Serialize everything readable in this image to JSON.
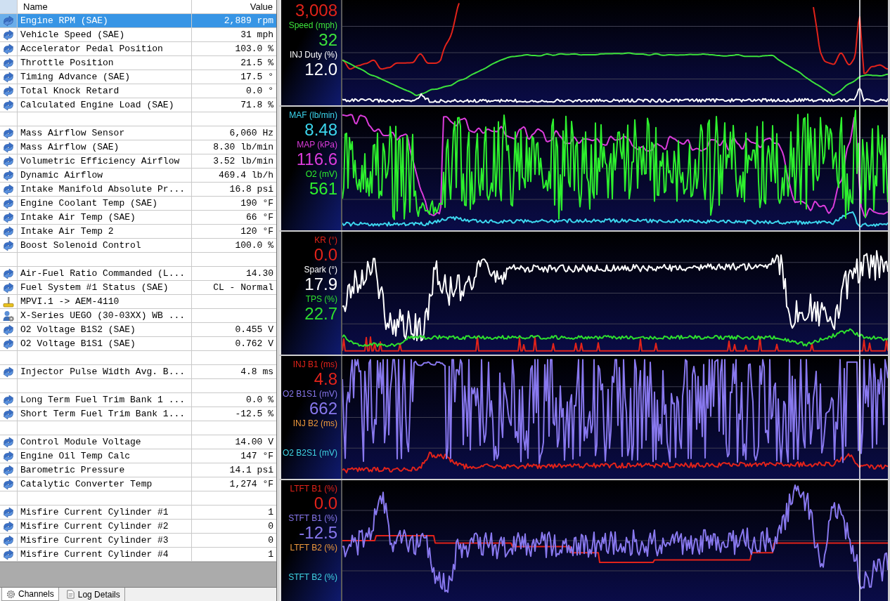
{
  "channel_table": {
    "columns": [
      "Name",
      "Value"
    ],
    "groups": [
      [
        {
          "kind": "channel",
          "name": "Engine RPM (SAE)",
          "value": "2,889 rpm",
          "selected": true
        },
        {
          "kind": "channel",
          "name": "Vehicle Speed (SAE)",
          "value": "31 mph",
          "selected": false
        },
        {
          "kind": "channel",
          "name": "Accelerator Pedal Position",
          "value": "103.0 %",
          "selected": false
        },
        {
          "kind": "channel",
          "name": "Throttle Position",
          "value": "21.5 %",
          "selected": false
        },
        {
          "kind": "channel",
          "name": "Timing Advance (SAE)",
          "value": "17.5 °",
          "selected": false
        },
        {
          "kind": "channel",
          "name": "Total Knock Retard",
          "value": "0.0 °",
          "selected": false
        },
        {
          "kind": "channel",
          "name": "Calculated Engine Load (SAE)",
          "value": "71.8 %",
          "selected": false
        }
      ],
      [
        {
          "kind": "channel",
          "name": "Mass Airflow Sensor",
          "value": "6,060 Hz",
          "selected": false
        },
        {
          "kind": "channel",
          "name": "Mass Airflow (SAE)",
          "value": "8.30 lb/min",
          "selected": false
        },
        {
          "kind": "channel",
          "name": "Volumetric Efficiency Airflow",
          "value": "3.52 lb/min",
          "selected": false
        },
        {
          "kind": "channel",
          "name": "Dynamic Airflow",
          "value": "469.4 lb/h",
          "selected": false
        },
        {
          "kind": "channel",
          "name": "Intake Manifold Absolute Pr...",
          "value": "16.8 psi",
          "selected": false
        },
        {
          "kind": "channel",
          "name": "Engine Coolant Temp (SAE)",
          "value": "190 °F",
          "selected": false
        },
        {
          "kind": "channel",
          "name": "Intake Air Temp (SAE)",
          "value": "66 °F",
          "selected": false
        },
        {
          "kind": "channel",
          "name": "Intake Air Temp 2",
          "value": "120 °F",
          "selected": false
        },
        {
          "kind": "channel",
          "name": "Boost Solenoid Control",
          "value": "100.0 %",
          "selected": false
        }
      ],
      [
        {
          "kind": "channel",
          "name": "Air-Fuel Ratio Commanded (L...",
          "value": "14.30",
          "selected": false
        },
        {
          "kind": "channel",
          "name": "Fuel System #1 Status (SAE)",
          "value": "CL - Normal",
          "selected": false
        },
        {
          "kind": "input",
          "name": "MPVI.1 -> AEM-4110",
          "selected": false
        },
        {
          "kind": "device",
          "name": "X-Series UEGO (30-03XX) WB ...",
          "selected": false
        },
        {
          "kind": "channel",
          "name": "O2 Voltage B1S2 (SAE)",
          "value": "0.455 V",
          "selected": false
        },
        {
          "kind": "channel",
          "name": "O2 Voltage B1S1 (SAE)",
          "value": "0.762 V",
          "selected": false
        }
      ],
      [
        {
          "kind": "channel",
          "name": "Injector Pulse Width Avg. B...",
          "value": "4.8 ms",
          "selected": false
        }
      ],
      [
        {
          "kind": "channel",
          "name": "Long Term Fuel Trim Bank 1 ...",
          "value": "0.0 %",
          "selected": false
        },
        {
          "kind": "channel",
          "name": "Short Term Fuel Trim Bank 1...",
          "value": "-12.5 %",
          "selected": false
        }
      ],
      [
        {
          "kind": "channel",
          "name": "Control Module Voltage",
          "value": "14.00 V",
          "selected": false
        },
        {
          "kind": "channel",
          "name": "Engine Oil Temp Calc",
          "value": "147 °F",
          "selected": false
        },
        {
          "kind": "channel",
          "name": "Barometric Pressure",
          "value": "14.1 psi",
          "selected": false
        },
        {
          "kind": "channel",
          "name": "Catalytic Converter Temp",
          "value": "1,274 °F",
          "selected": false
        }
      ],
      [
        {
          "kind": "channel",
          "name": "Misfire Current Cylinder #1",
          "value": "1",
          "selected": false
        },
        {
          "kind": "channel",
          "name": "Misfire Current Cylinder #2",
          "value": "0",
          "selected": false
        },
        {
          "kind": "channel",
          "name": "Misfire Current Cylinder #3",
          "value": "0",
          "selected": false
        },
        {
          "kind": "channel",
          "name": "Misfire Current Cylinder #4",
          "value": "1",
          "selected": false
        }
      ]
    ]
  },
  "tabs": [
    {
      "label": "Channels",
      "selected": true
    },
    {
      "label": "Log Details",
      "selected": false
    }
  ],
  "chart_panels": [
    {
      "channels": [
        {
          "value": "3,008",
          "color": "#e2231a"
        },
        {
          "label": "Speed (mph)",
          "value": "32",
          "color": "#3ce23c"
        },
        {
          "label": "INJ Duty (%)",
          "value": "12.0",
          "color": "#ffffff"
        }
      ]
    },
    {
      "channels": [
        {
          "label": "MAF (lb/min)",
          "value": "8.48",
          "color": "#3cd6ee"
        },
        {
          "label": "MAP (kPa)",
          "value": "116.6",
          "color": "#dc3cdc"
        },
        {
          "label": "O2 (mV)",
          "value": "561",
          "color": "#2ef02e"
        }
      ]
    },
    {
      "channels": [
        {
          "label": "KR (°)",
          "value": "0.0",
          "color": "#e2231a"
        },
        {
          "label": "Spark (°)",
          "value": "17.9",
          "color": "#ffffff"
        },
        {
          "label": "TPS (%)",
          "value": "22.7",
          "color": "#2ee02e"
        }
      ]
    },
    {
      "channels": [
        {
          "label": "INJ B1 (ms)",
          "value": "4.8",
          "color": "#e2231a"
        },
        {
          "label": "O2 B1S1 (mV)",
          "value": "662",
          "color": "#8878ee"
        },
        {
          "label": "INJ B2 (ms)",
          "color": "#f09a3c"
        },
        {
          "label": "O2 B2S1 (mV)",
          "color": "#40d4e4"
        }
      ]
    },
    {
      "channels": [
        {
          "label": "LTFT B1 (%)",
          "value": "0.0",
          "color": "#e2231a"
        },
        {
          "label": "STFT B1 (%)",
          "value": "-12.5",
          "color": "#8878ee"
        },
        {
          "label": "LTFT B2 (%)",
          "color": "#f09a3c"
        },
        {
          "label": "STFT B2 (%)",
          "color": "#40d4e4"
        }
      ]
    }
  ]
}
